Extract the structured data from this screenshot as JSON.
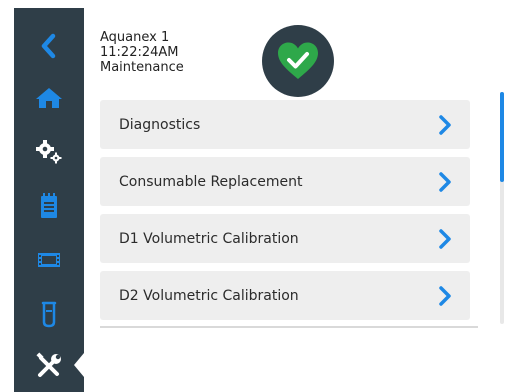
{
  "header": {
    "device_name": "Aquanex 1",
    "time": "11:22:24AM",
    "mode": "Maintenance"
  },
  "status": {
    "icon": "heart-check-icon",
    "state_color": "#2ea84a"
  },
  "sidebar": {
    "items": [
      {
        "icon": "back-chevron-icon"
      },
      {
        "icon": "home-icon"
      },
      {
        "icon": "gears-icon"
      },
      {
        "icon": "notepad-icon"
      },
      {
        "icon": "film-strip-icon"
      },
      {
        "icon": "beaker-icon"
      },
      {
        "icon": "tools-icon",
        "active": true
      }
    ]
  },
  "menu": {
    "items": [
      {
        "label": "Diagnostics"
      },
      {
        "label": "Consumable Replacement"
      },
      {
        "label": "D1 Volumetric Calibration"
      },
      {
        "label": "D2 Volumetric Calibration"
      }
    ]
  },
  "scroll": {
    "position_fraction": 0.0,
    "visible_fraction": 0.39
  },
  "colors": {
    "sidebar": "#2f3e48",
    "accent": "#1e88e5",
    "ok": "#2ea84a"
  }
}
